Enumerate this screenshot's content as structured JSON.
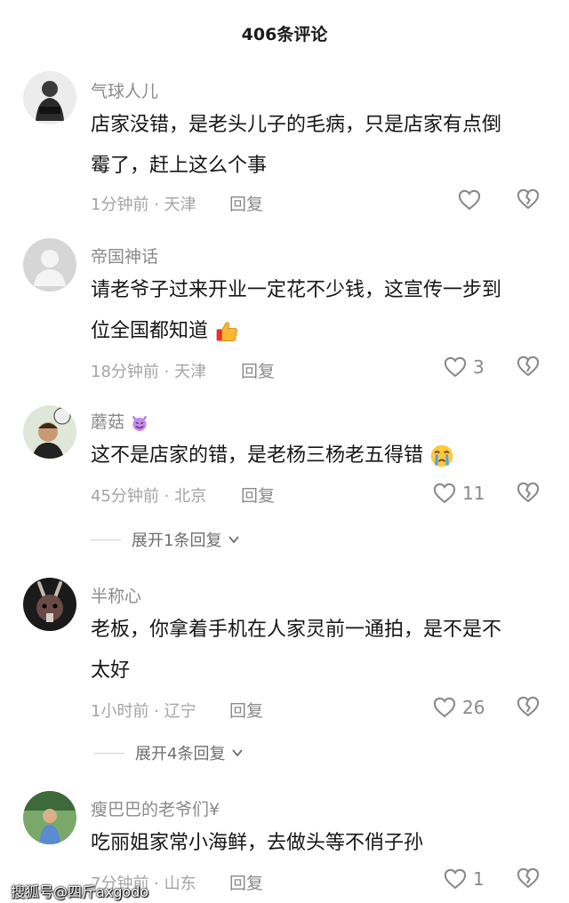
{
  "header": {
    "title": "406条评论"
  },
  "comments": [
    {
      "user": "气球人儿",
      "text_lines": [
        "店家没错，是老头儿子的毛病，只是店家有点倒",
        "霉了，赶上这么个事"
      ],
      "meta": "1分钟前 · 天津",
      "reply": "回复",
      "likes": ""
    },
    {
      "user": "帝国神话",
      "text_lines": [
        "请老爷子过来开业一定花不少钱，这宣传一步到",
        "位全国都知道"
      ],
      "meta": "18分钟前 · 天津",
      "reply": "回复",
      "likes": "3"
    },
    {
      "user": "蘑菇",
      "text_lines": [
        "这不是店家的错，是老杨三杨老五得错"
      ],
      "meta": "45分钟前 · 北京",
      "reply": "回复",
      "likes": "11",
      "expand": "展开1条回复"
    },
    {
      "user": "半称心",
      "text_lines": [
        "老板，你拿着手机在人家灵前一通拍，是不是不",
        "太好"
      ],
      "meta": "1小时前 · 辽宁",
      "reply": "回复",
      "likes": "26",
      "expand": "展开4条回复"
    },
    {
      "user": "瘦巴巴的老爷们¥",
      "text_lines": [
        "吃丽姐家常小海鲜，去做头等不俏子孙"
      ],
      "meta": "7分钟前 · 山东",
      "reply": "回复",
      "likes": "1"
    }
  ],
  "icons": {
    "like": "heart-outline-icon",
    "dislike": "broken-heart-icon",
    "expand": "chevron-down-icon",
    "emoji_thumbs": "thumbs-up-emoji",
    "emoji_cry": "crying-emoji",
    "emoji_devil": "smiling-devil-emoji"
  },
  "colors": {
    "primary_text": "#161616",
    "secondary_text": "#8a8a8a",
    "meta_text": "#a4a4a4"
  },
  "watermark": "搜狐号@四斤axgodo"
}
